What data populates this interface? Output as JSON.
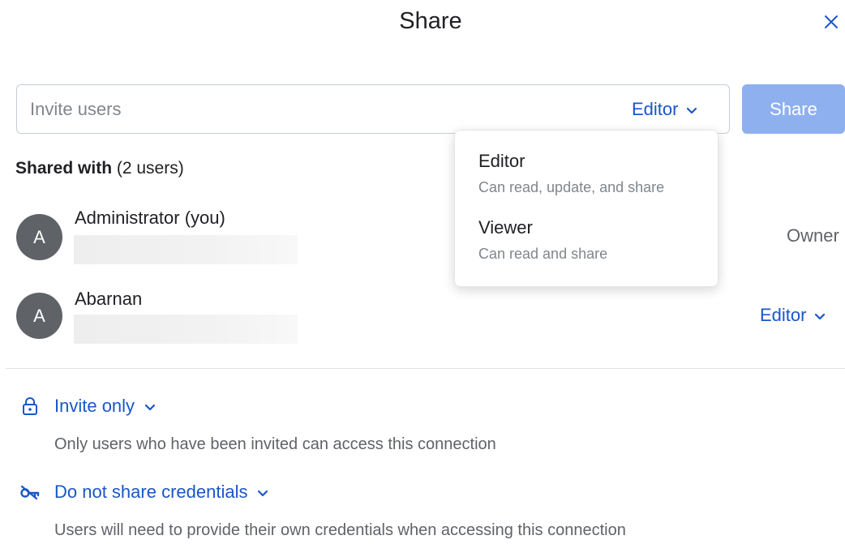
{
  "dialog": {
    "title": "Share",
    "close_icon": "close-icon"
  },
  "invite": {
    "placeholder": "Invite users",
    "value": "",
    "role_label": "Editor",
    "share_button_label": "Share"
  },
  "shared_with": {
    "label_bold": "Shared with",
    "count_text": "(2 users)"
  },
  "users": [
    {
      "initial": "A",
      "name": "Administrator (you)",
      "role": "Owner"
    },
    {
      "initial": "A",
      "name": "Abarnan",
      "role": "Editor"
    }
  ],
  "role_menu": {
    "items": [
      {
        "title": "Editor",
        "description": "Can read, update, and share"
      },
      {
        "title": "Viewer",
        "description": "Can read and share"
      }
    ]
  },
  "access": {
    "label": "Invite only",
    "description": "Only users who have been invited can access this connection",
    "icon": "lock-icon"
  },
  "credentials": {
    "label": "Do not share credentials",
    "description": "Users will need to provide their own credentials when accessing this connection",
    "icon": "key-off-icon"
  },
  "colors": {
    "accent": "#1a56c8",
    "share_button_bg": "#8fb0ef",
    "avatar_bg": "#5f6368"
  }
}
